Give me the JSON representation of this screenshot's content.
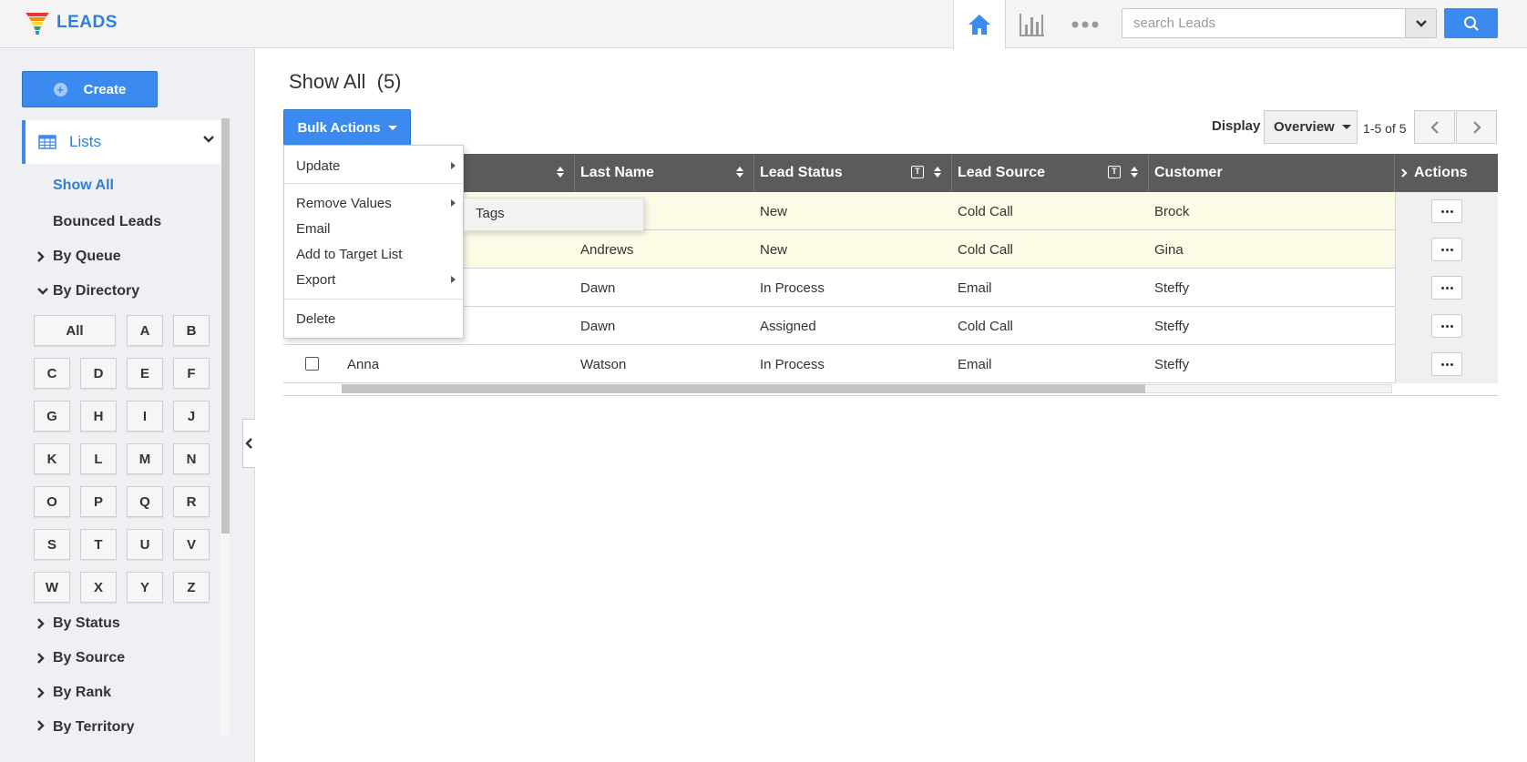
{
  "app": {
    "logo_text": "LEADS"
  },
  "topbar": {
    "search_placeholder": "search Leads",
    "icons": [
      "home-icon",
      "chart-icon",
      "more-icon"
    ]
  },
  "sidebar": {
    "create_label": "Create",
    "lists_label": "Lists",
    "show_all": "Show All",
    "bounced": "Bounced Leads",
    "groups": {
      "queue": "By Queue",
      "directory": "By Directory",
      "status": "By Status",
      "source": "By Source",
      "rank": "By Rank",
      "territory": "By Territory"
    },
    "directory_letters": [
      "All",
      "A",
      "B",
      "C",
      "D",
      "E",
      "F",
      "G",
      "H",
      "I",
      "J",
      "K",
      "L",
      "M",
      "N",
      "O",
      "P",
      "Q",
      "R",
      "S",
      "T",
      "U",
      "V",
      "W",
      "X",
      "Y",
      "Z"
    ]
  },
  "main": {
    "title": "Show All",
    "count": "(5)",
    "bulk_label": "Bulk Actions",
    "display_label": "Display",
    "display_value": "Overview",
    "range": "1-5 of 5"
  },
  "menu": {
    "update": "Update",
    "remove_values": "Remove Values",
    "email": "Email",
    "add_target": "Add to Target List",
    "export": "Export",
    "delete": "Delete",
    "sub_tags": "Tags"
  },
  "table": {
    "headers": {
      "last_name": "Last Name",
      "lead_status": "Lead Status",
      "lead_source": "Lead Source",
      "customer": "Customer",
      "actions": "Actions"
    },
    "rows": [
      {
        "first": "",
        "last": "",
        "status": "New",
        "source": "Cold Call",
        "customer": "Brock"
      },
      {
        "first": "",
        "last": "Andrews",
        "status": "New",
        "source": "Cold Call",
        "customer": "Gina"
      },
      {
        "first": "",
        "last": "Dawn",
        "status": "In Process",
        "source": "Email",
        "customer": "Steffy"
      },
      {
        "first": "",
        "last": "Dawn",
        "status": "Assigned",
        "source": "Cold Call",
        "customer": "Steffy"
      },
      {
        "first": "Anna",
        "last": "Watson",
        "status": "In Process",
        "source": "Email",
        "customer": "Steffy"
      }
    ]
  },
  "colors": {
    "accent": "#3a8af0",
    "header_bg": "#5b5b5b",
    "highlight_row": "#fbfbe6"
  }
}
